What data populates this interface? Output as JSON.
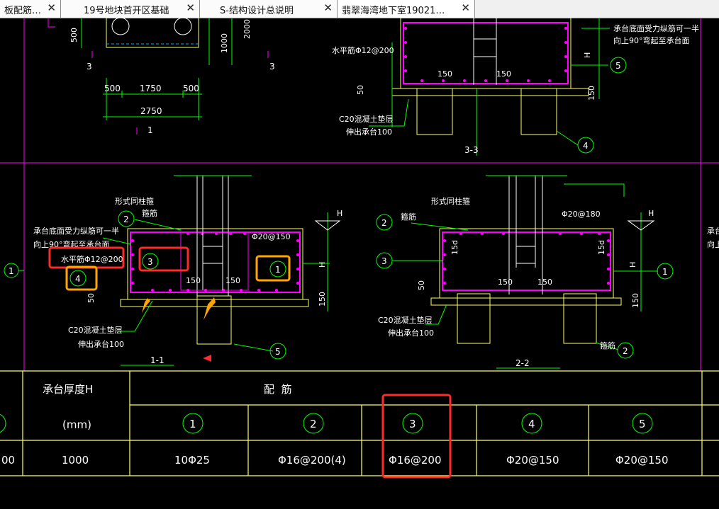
{
  "tabs": [
    {
      "label": "板配筋…",
      "close": "✕"
    },
    {
      "label": "19号地块首开区基础",
      "close": "✕"
    },
    {
      "label": "S-结构设计总说明",
      "close": "✕"
    },
    {
      "label": "翡翠海湾地下室19021…",
      "close": "✕"
    }
  ],
  "drawing": {
    "top_left": {
      "dim_500_left": "500",
      "dim_1750": "1750",
      "dim_500_right": "500",
      "dim_2750": "2750",
      "dim_500_vert": "500",
      "dim_1000": "1000",
      "dim_2000": "2000",
      "mark_3_left": "3",
      "mark_3_right": "3",
      "mark_1": "1"
    },
    "section_3_3": {
      "note_top": "承台底面受力纵筋可一半",
      "note_bottom": "向上90°弯起至承台面",
      "horizontal_bar": "水平筋Φ12@200",
      "dim_150_a": "150",
      "dim_150_b": "150",
      "dim_50": "50",
      "dim_150_side": "150",
      "h_label": "H",
      "cushion_1": "C20混凝土垫层",
      "cushion_2": "伸出承台100",
      "title": "3-3",
      "callout_5": "5",
      "callout_4": "4"
    },
    "section_1_1": {
      "column_bar": "形式同柱箍",
      "stirrup": "箍筋",
      "note_top": "承台底面受力纵筋可一半",
      "note_bottom": "向上90°弯起至承台面",
      "horizontal_bar": "水平筋Φ12@200",
      "top_bar": "Φ20@150",
      "dim_150_a": "150",
      "dim_150_b": "150",
      "dim_50": "50",
      "dim_150_side": "150",
      "h_top": "H",
      "h_side": "H",
      "cushion_1": "C20混凝土垫层",
      "cushion_2": "伸出承台100",
      "title": "1-1",
      "callout_2": "2",
      "callout_3": "3",
      "callout_4": "4",
      "callout_1": "1",
      "callout_5": "5",
      "left_callout_1": "1"
    },
    "section_2_2": {
      "column_bar": "形式同柱箍",
      "stirrup": "箍筋",
      "top_bar": "Φ20@180",
      "dim_15d_left": "15d",
      "dim_15d_right": "15d",
      "dim_150_a": "150",
      "dim_150_b": "150",
      "dim_50": "50",
      "dim_150_side": "150",
      "h_top": "H",
      "h_side": "H",
      "cushion_1": "C20混凝土垫层",
      "cushion_2": "伸出承台100",
      "stirrup_bottom": "箍筋",
      "title": "2-2",
      "callout_2": "2",
      "callout_3": "3",
      "callout_1": "1",
      "callout_2b": "2"
    },
    "right_edge": {
      "note_top": "承台",
      "note_bottom": "向上"
    }
  },
  "table": {
    "header_thickness": "承台厚度H",
    "header_unit": "(mm)",
    "header_rebar": "配  筋",
    "columns": [
      "1",
      "2",
      "3",
      "4",
      "5"
    ],
    "row": {
      "prev": "00",
      "thickness": "1000",
      "values": [
        "10Φ25",
        "Φ16@200(4)",
        "Φ16@200",
        "Φ20@150",
        "Φ20@150"
      ]
    }
  },
  "colors": {
    "cad_text": "#ffffff",
    "dimension": "#00ff00",
    "rebar": "#ff00ff",
    "outline": "#ffff66",
    "highlight_red": "#ff2a2a",
    "highlight_orange": "#ffa500"
  }
}
